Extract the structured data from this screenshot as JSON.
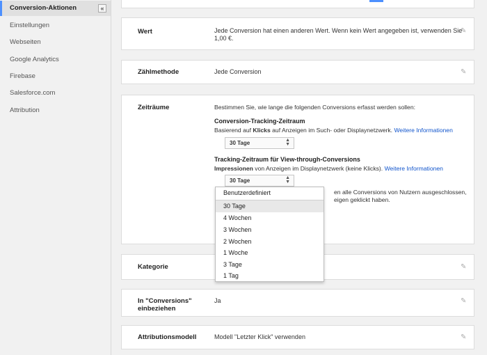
{
  "sidebar": {
    "collapse_icon": "«",
    "items": [
      {
        "label": "Conversion-Aktionen"
      },
      {
        "label": "Einstellungen"
      },
      {
        "label": "Webseiten"
      },
      {
        "label": "Google Analytics"
      },
      {
        "label": "Firebase"
      },
      {
        "label": "Salesforce.com"
      },
      {
        "label": "Attribution"
      }
    ]
  },
  "cards": {
    "wert": {
      "label": "Wert",
      "value_line1": "Jede Conversion hat einen anderen Wert. Wenn kein Wert angegeben ist, verwenden Sie",
      "value_line2": "1,00 €."
    },
    "zaehlmethode": {
      "label": "Zählmethode",
      "value": "Jede Conversion"
    },
    "zeitraeume": {
      "label": "Zeiträume",
      "intro": "Bestimmen Sie, wie lange die folgenden Conversions erfasst werden sollen:",
      "ct_title": "Conversion-Tracking-Zeitraum",
      "ct_pre": "Basierend auf ",
      "ct_bold": "Klicks",
      "ct_post": " auf Anzeigen im Such- oder Displaynetzwerk. ",
      "ct_link": "Weitere Informationen",
      "ct_select": "30 Tage",
      "vt_title": "Tracking-Zeitraum für View-through-Conversions",
      "vt_bold": "Impressionen",
      "vt_post": " von Anzeigen im Displaynetzwerk (keine Klicks). ",
      "vt_link": "Weitere Informationen",
      "vt_select": "30 Tage",
      "hidden_line1": "en alle Conversions von Nutzern ausgeschlossen,",
      "hidden_line2": "eigen geklickt haben."
    },
    "kategorie": {
      "label": "Kategorie"
    },
    "in_conversions": {
      "label_line1": "In \"Conversions\"",
      "label_line2": "einbeziehen",
      "value": "Ja"
    },
    "attributionsmodell": {
      "label": "Attributionsmodell",
      "value": "Modell \"Letzter Klick\" verwenden"
    }
  },
  "dropdown": {
    "options": [
      "Benutzerdefiniert",
      "30 Tage",
      "4 Wochen",
      "3 Wochen",
      "2 Wochen",
      "1 Woche",
      "3 Tage",
      "1 Tag"
    ],
    "selected": "30 Tage"
  },
  "icons": {
    "edit": "pencil-icon",
    "select_arrows": "updown-arrows-icon"
  },
  "colors": {
    "accent": "#4d90fe",
    "link": "#1155cc"
  }
}
